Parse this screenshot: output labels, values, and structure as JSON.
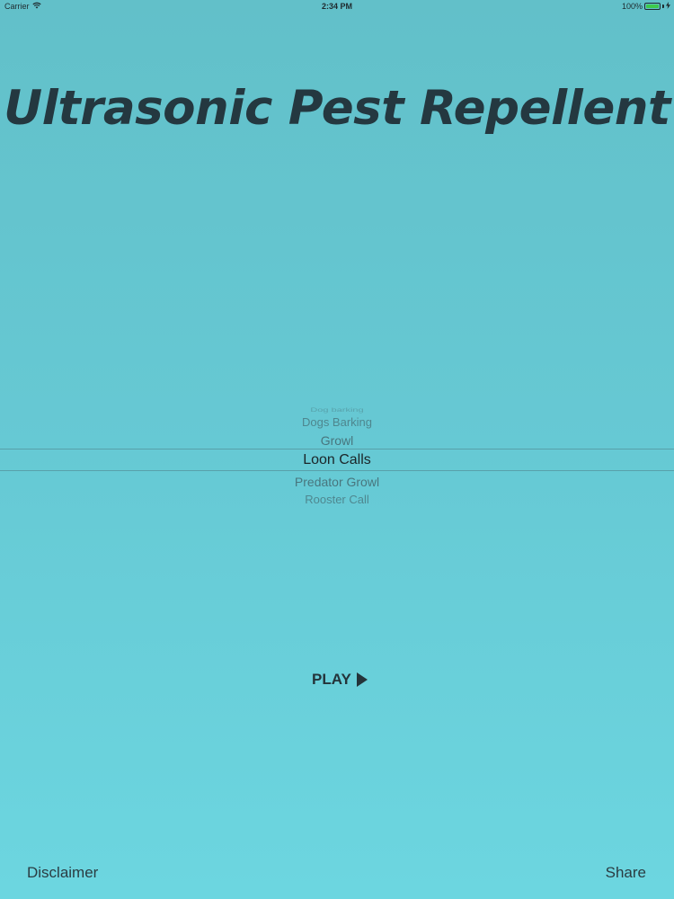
{
  "status_bar": {
    "carrier": "Carrier",
    "time": "2:34 PM",
    "battery": "100%",
    "battery_level": 1.0,
    "wifi_icon": "wifi-icon",
    "charging_icon": "bolt-icon"
  },
  "app": {
    "title": "Ultrasonic Pest Repellent"
  },
  "picker": {
    "items": [
      "Dog barking",
      "Dogs Barking",
      "Growl",
      "Loon Calls",
      "Predator Growl",
      "Rooster Call"
    ],
    "selected_index": 3
  },
  "controls": {
    "play_label": "PLAY",
    "play_icon": "play-triangle-icon"
  },
  "footer": {
    "disclaimer_label": "Disclaimer",
    "share_label": "Share"
  },
  "colors": {
    "background_top": "#62c0c9",
    "background_bottom": "#6cd6e0",
    "title": "#243840",
    "battery_fill": "#3ec94c"
  }
}
